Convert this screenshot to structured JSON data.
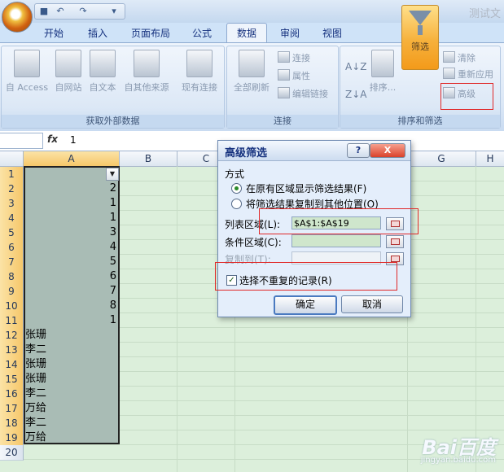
{
  "window": {
    "title": "测试文"
  },
  "tabs": [
    {
      "label": "开始"
    },
    {
      "label": "插入"
    },
    {
      "label": "页面布局"
    },
    {
      "label": "公式"
    },
    {
      "label": "数据",
      "active": true
    },
    {
      "label": "审阅"
    },
    {
      "label": "视图"
    }
  ],
  "ribbon": {
    "get_external": {
      "label": "获取外部数据",
      "buttons": [
        "自 Access",
        "自网站",
        "自文本",
        "自其他来源",
        "现有连接"
      ]
    },
    "connections": {
      "label": "连接",
      "refresh_all": "全部刷新",
      "connections": "连接",
      "properties": "属性",
      "edit_links": "编辑链接"
    },
    "sort_filter": {
      "label": "排序和筛选",
      "sort": "排序...",
      "filter": "筛选",
      "clear": "清除",
      "reapply": "重新应用",
      "advanced": "高级"
    }
  },
  "formula_bar": {
    "fx": "fx",
    "value": "1"
  },
  "sheet": {
    "columns": [
      "A",
      "B",
      "C",
      "G",
      "H"
    ],
    "rows": [
      "1",
      "2",
      "3",
      "4",
      "5",
      "6",
      "7",
      "8",
      "9",
      "10",
      "11",
      "12",
      "13",
      "14",
      "15",
      "16",
      "17",
      "18",
      "19",
      "20"
    ],
    "col_a": [
      "",
      "2",
      "1",
      "1",
      "3",
      "4",
      "5",
      "6",
      "7",
      "8",
      "1",
      "张珊",
      "李二",
      "张珊",
      "张珊",
      "李二",
      "万给",
      "李二",
      "万给"
    ]
  },
  "dialog": {
    "title": "高级筛选",
    "help": "?",
    "close": "X",
    "section": "方式",
    "option_inplace": "在原有区域显示筛选结果(F)",
    "option_copy": "将筛选结果复制到其他位置(O)",
    "list_range_label": "列表区域(L):",
    "list_range_value": "$A$1:$A$19",
    "criteria_label": "条件区域(C):",
    "copy_to_label": "复制到(T):",
    "unique_label": "选择不重复的记录(R)",
    "ok": "确定",
    "cancel": "取消"
  },
  "watermark": {
    "brand": "Bai百度",
    "sub": "jingyan.baidu.com"
  },
  "colors": {
    "selection": "#a9bcb5",
    "sheet_bg": "#dcefdb",
    "highlight_box": "#e02828"
  }
}
